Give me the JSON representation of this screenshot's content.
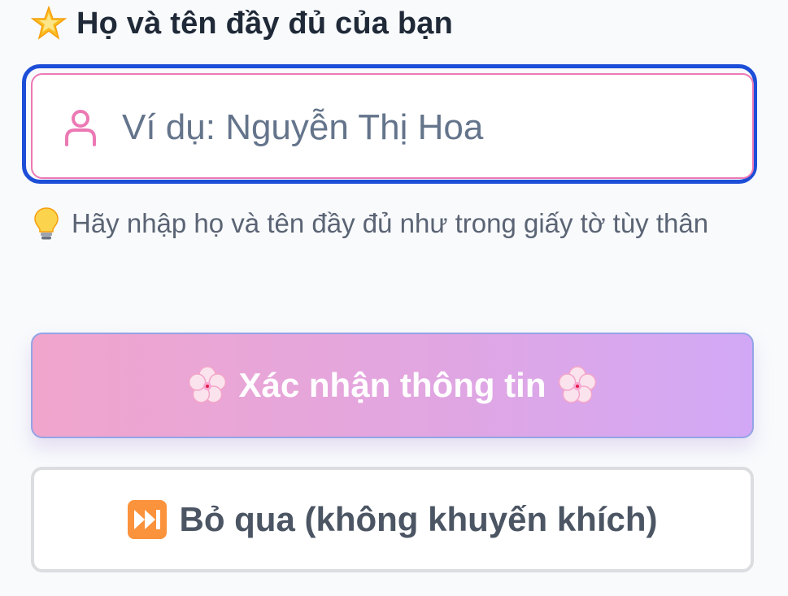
{
  "form": {
    "field_label": "Họ và tên đầy đủ của bạn",
    "field_icon": "glowing-star-icon",
    "input": {
      "value": "",
      "placeholder": "Ví dụ: Nguyễn Thị Hoa",
      "icon": "user-icon"
    },
    "hint": {
      "icon": "light-bulb-icon",
      "text": "Hãy nhập họ và tên đầy đủ như trong giấy tờ tùy thân"
    }
  },
  "actions": {
    "confirm": {
      "label": "Xác nhận thông tin",
      "icon": "cherry-blossom-icon"
    },
    "skip": {
      "label": "Bỏ qua (không khuyến khích)",
      "icon": "fast-forward-icon"
    }
  },
  "colors": {
    "focus_ring": "#1d4ed8",
    "input_border": "#ec79b4",
    "gradient_start": "#f0a5cc",
    "gradient_end": "#d2a8f6",
    "text_dark": "#1f2937",
    "placeholder": "#64748b"
  }
}
